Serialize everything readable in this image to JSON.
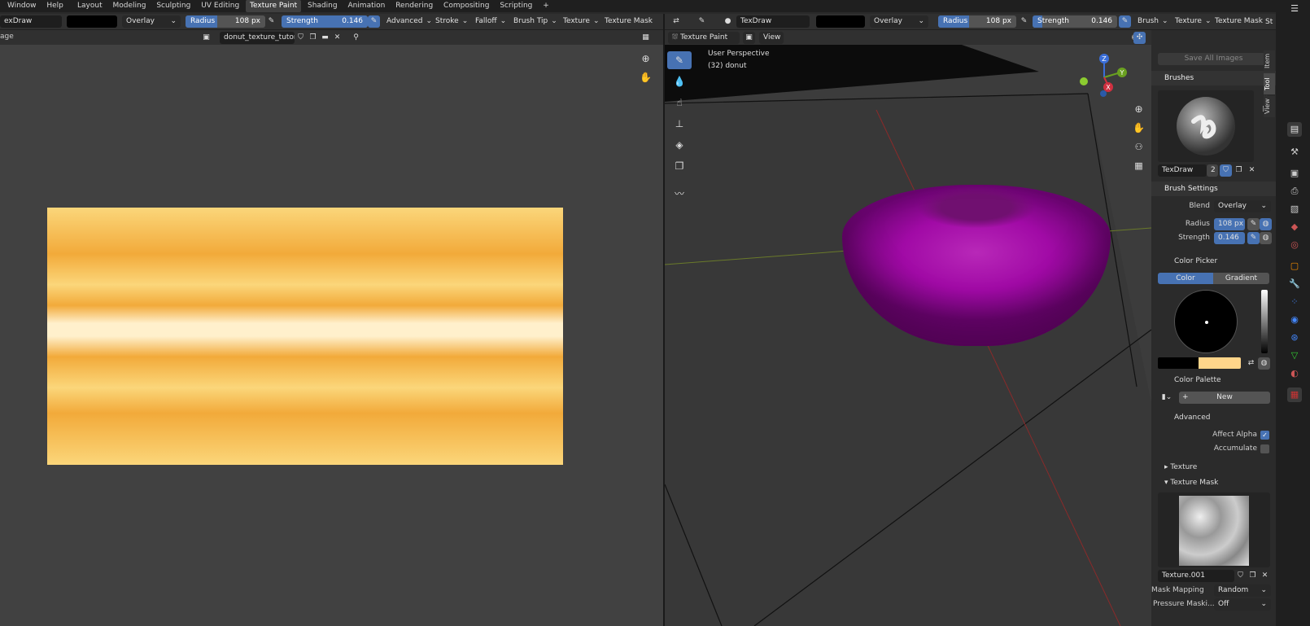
{
  "menu": {
    "window": "Window",
    "help": "Help"
  },
  "workspaces": [
    "Layout",
    "Modeling",
    "Sculpting",
    "UV Editing",
    "Texture Paint",
    "Shading",
    "Animation",
    "Rendering",
    "Compositing",
    "Scripting",
    "+"
  ],
  "left_header": {
    "brush": "exDraw",
    "blend": "Overlay",
    "radius_label": "Radius",
    "radius_value": "108 px",
    "strength_label": "Strength",
    "strength_value": "0.146",
    "menus": [
      "Advanced",
      "Stroke",
      "Falloff",
      "Brush Tip",
      "Texture",
      "Texture Mask"
    ],
    "color": "#000000"
  },
  "image_editor": {
    "mode_label": "age",
    "image_name": "donut_texture_tutori...",
    "texture_colors": [
      "#fbd67a",
      "#f2aa3a",
      "#fff0cc"
    ]
  },
  "right_header": {
    "brush": "TexDraw",
    "blend": "Overlay",
    "radius_label": "Radius",
    "radius_value": "108 px",
    "strength_label": "Strength",
    "strength_value": "0.146",
    "menus": [
      "Brush",
      "Texture",
      "Texture Mask",
      "St"
    ]
  },
  "viewport": {
    "mode": "Texture Paint",
    "view_menu": "View",
    "perspective": "User Perspective",
    "object": "(32) donut",
    "donut_color": "#a10aa6",
    "axes": {
      "z": "Z",
      "y": "Y",
      "x": "X"
    }
  },
  "npanel": {
    "save_all": "Save All Images",
    "brushes_title": "Brushes",
    "brush_name": "TexDraw",
    "brush_users": "2",
    "brush_settings_title": "Brush Settings",
    "blend_label": "Blend",
    "blend_value": "Overlay",
    "radius_label": "Radius",
    "radius_value": "108 px",
    "strength_label": "Strength",
    "strength_value": "0.146",
    "color_picker_title": "Color Picker",
    "color_tab": "Color",
    "gradient_tab": "Gradient",
    "primary_color": "#000000",
    "secondary_color": "#ffd58a",
    "color_palette_title": "Color Palette",
    "new_label": "New",
    "advanced_title": "Advanced",
    "affect_alpha": "Affect Alpha",
    "accumulate": "Accumulate",
    "texture_title": "Texture",
    "texture_mask_title": "Texture Mask",
    "mask_texture_name": "Texture.001",
    "mask_mapping_label": "Mask Mapping",
    "mask_mapping_value": "Random",
    "pressure_label": "Pressure Maski...",
    "pressure_value": "Off"
  },
  "side_tabs": {
    "item": "Item",
    "tool": "Tool",
    "view": "View"
  },
  "accent": "#4772b3"
}
